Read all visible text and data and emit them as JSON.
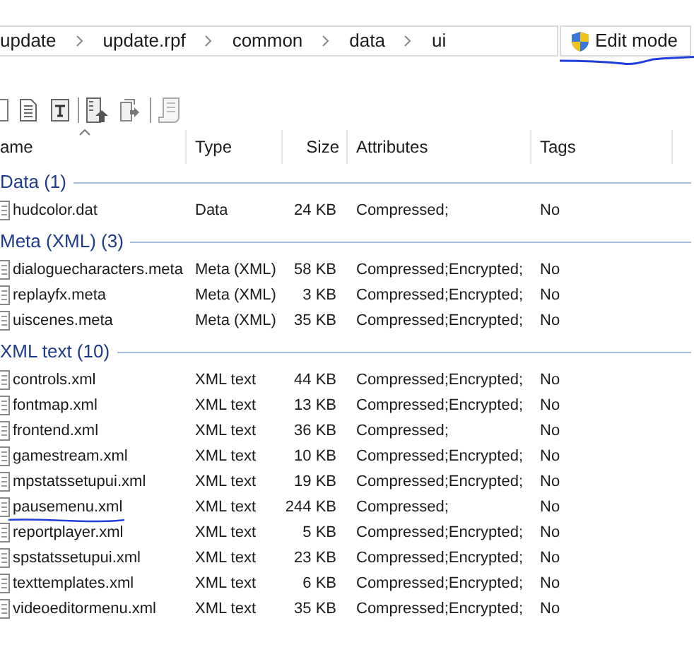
{
  "breadcrumb": [
    "update",
    "update.rpf",
    "common",
    "data",
    "ui"
  ],
  "edit_mode_button": {
    "label": "Edit mode",
    "underlined": true
  },
  "columns": [
    {
      "label": "ame",
      "sorted": true
    },
    {
      "label": "Type",
      "sorted": false
    },
    {
      "label": "Size",
      "sorted": false
    },
    {
      "label": "Attributes",
      "sorted": false
    },
    {
      "label": "Tags",
      "sorted": false
    }
  ],
  "groups": [
    {
      "title": "Data (1)",
      "rows": [
        {
          "name": "hudcolor.dat",
          "type": "Data",
          "size": "24 KB",
          "attributes": "Compressed;",
          "tags": "No",
          "underlined": false
        }
      ]
    },
    {
      "title": "Meta (XML) (3)",
      "rows": [
        {
          "name": "dialoguecharacters.meta",
          "type": "Meta (XML)",
          "size": "58 KB",
          "attributes": "Compressed;Encrypted;",
          "tags": "No",
          "underlined": false
        },
        {
          "name": "replayfx.meta",
          "type": "Meta (XML)",
          "size": "3 KB",
          "attributes": "Compressed;Encrypted;",
          "tags": "No",
          "underlined": false
        },
        {
          "name": "uiscenes.meta",
          "type": "Meta (XML)",
          "size": "35 KB",
          "attributes": "Compressed;Encrypted;",
          "tags": "No",
          "underlined": false
        }
      ]
    },
    {
      "title": "XML text (10)",
      "rows": [
        {
          "name": "controls.xml",
          "type": "XML text",
          "size": "44 KB",
          "attributes": "Compressed;Encrypted;",
          "tags": "No",
          "underlined": false
        },
        {
          "name": "fontmap.xml",
          "type": "XML text",
          "size": "13 KB",
          "attributes": "Compressed;Encrypted;",
          "tags": "No",
          "underlined": false
        },
        {
          "name": "frontend.xml",
          "type": "XML text",
          "size": "36 KB",
          "attributes": "Compressed;",
          "tags": "No",
          "underlined": false
        },
        {
          "name": "gamestream.xml",
          "type": "XML text",
          "size": "10 KB",
          "attributes": "Compressed;Encrypted;",
          "tags": "No",
          "underlined": false
        },
        {
          "name": "mpstatssetupui.xml",
          "type": "XML text",
          "size": "19 KB",
          "attributes": "Compressed;Encrypted;",
          "tags": "No",
          "underlined": false
        },
        {
          "name": "pausemenu.xml",
          "type": "XML text",
          "size": "244 KB",
          "attributes": "Compressed;",
          "tags": "No",
          "underlined": true
        },
        {
          "name": "reportplayer.xml",
          "type": "XML text",
          "size": "5 KB",
          "attributes": "Compressed;Encrypted;",
          "tags": "No",
          "underlined": false
        },
        {
          "name": "spstatssetupui.xml",
          "type": "XML text",
          "size": "23 KB",
          "attributes": "Compressed;Encrypted;",
          "tags": "No",
          "underlined": false
        },
        {
          "name": "texttemplates.xml",
          "type": "XML text",
          "size": "6 KB",
          "attributes": "Compressed;Encrypted;",
          "tags": "No",
          "underlined": false
        },
        {
          "name": "videoeditormenu.xml",
          "type": "XML text",
          "size": "35 KB",
          "attributes": "Compressed;Encrypted;",
          "tags": "No",
          "underlined": false
        }
      ]
    }
  ]
}
